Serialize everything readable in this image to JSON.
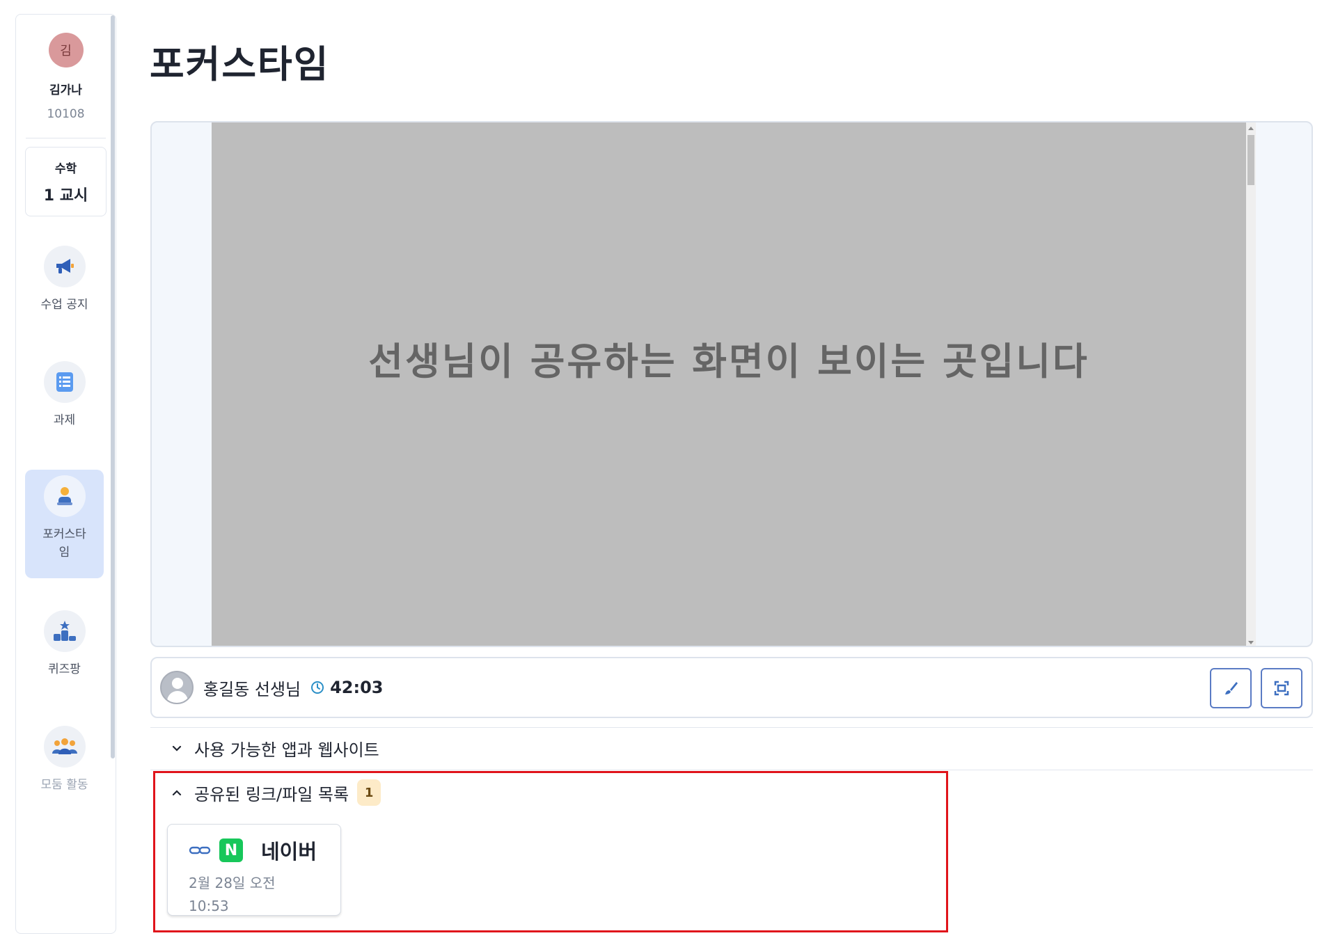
{
  "sidebar": {
    "profile": {
      "avatar_initial": "김",
      "name": "김가나",
      "student_id": "10108"
    },
    "period": {
      "subject": "수학",
      "period": "1 교시"
    },
    "items": [
      {
        "label": "수업 공지",
        "icon": "megaphone-icon"
      },
      {
        "label": "과제",
        "icon": "list-icon"
      },
      {
        "label": "포커스타\n임",
        "icon": "focus-person-icon",
        "active": true
      },
      {
        "label": "퀴즈팡",
        "icon": "podium-icon"
      },
      {
        "label": "모둠 활동",
        "icon": "group-icon",
        "muted": true
      }
    ]
  },
  "main": {
    "title": "포커스타임",
    "screen_placeholder": "선생님이 공유하는 화면이 보이는 곳입니다",
    "teacher": {
      "name": "홍길동 선생님",
      "timer": "42:03"
    },
    "apps_section": {
      "label": "사용 가능한 앱과 웹사이트",
      "expanded": false
    },
    "shared_section": {
      "label": "공유된 링크/파일 목록",
      "count": "1",
      "expanded": true
    },
    "shared_items": [
      {
        "logo_letter": "N",
        "title": "네이버",
        "date": "2월 28일 오전 10:53"
      }
    ]
  },
  "colors": {
    "accent": "#5a7bc4",
    "active_nav_bg": "#d8e4fb",
    "highlight_border": "#e0141b",
    "naver_green": "#17c75a",
    "badge_bg": "#fdebc8",
    "screen_bg": "#bdbdbd"
  }
}
